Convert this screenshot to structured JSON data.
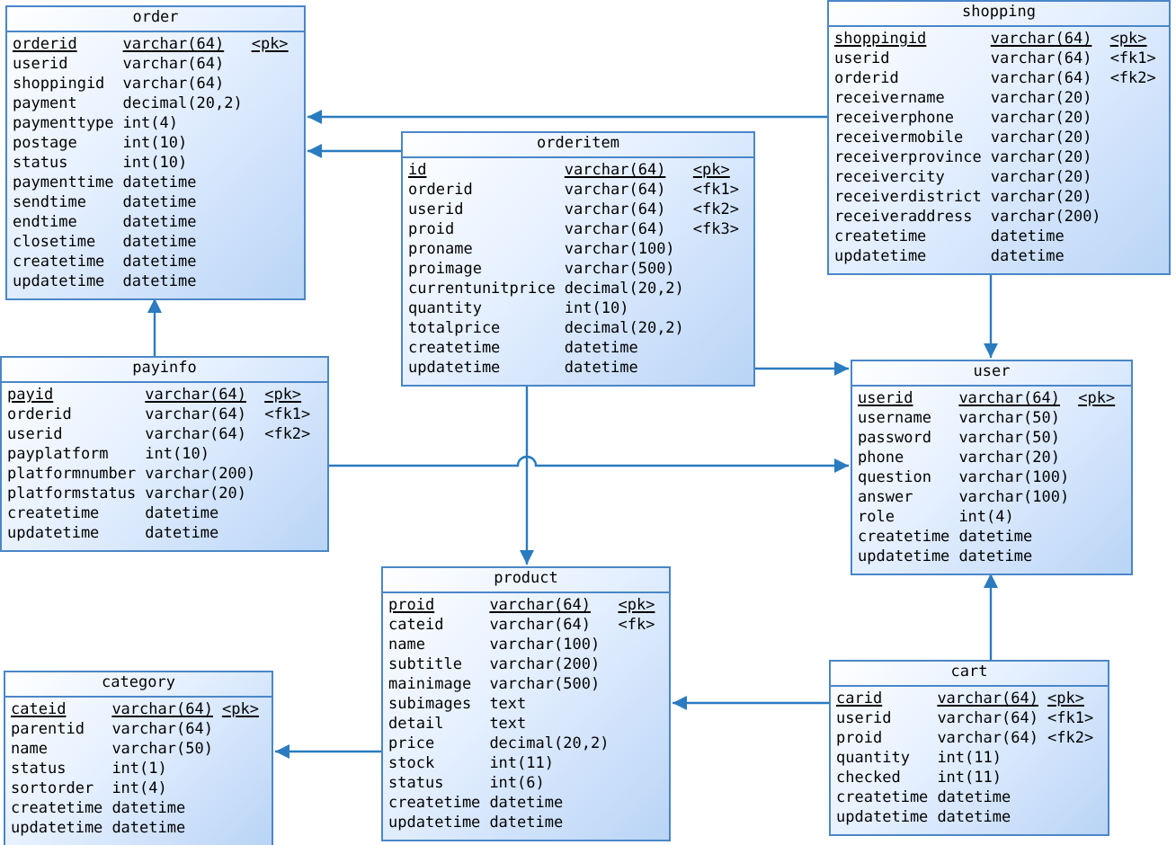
{
  "tables": [
    {
      "name": "order",
      "columns": [
        {
          "name": "orderid",
          "type": "varchar(64)",
          "key": "<pk>",
          "primary_key": true
        },
        {
          "name": "userid",
          "type": "varchar(64)",
          "primary_key": false
        },
        {
          "name": "shoppingid",
          "type": "varchar(64)",
          "primary_key": false
        },
        {
          "name": "payment",
          "type": "decimal(20,2)",
          "primary_key": false
        },
        {
          "name": "paymenttype",
          "type": "int(4)",
          "primary_key": false
        },
        {
          "name": "postage",
          "type": "int(10)",
          "primary_key": false
        },
        {
          "name": "status",
          "type": "int(10)",
          "primary_key": false
        },
        {
          "name": "paymenttime",
          "type": "datetime",
          "primary_key": false
        },
        {
          "name": "sendtime",
          "type": "datetime",
          "primary_key": false
        },
        {
          "name": "endtime",
          "type": "datetime",
          "primary_key": false
        },
        {
          "name": "closetime",
          "type": "datetime",
          "primary_key": false
        },
        {
          "name": "createtime",
          "type": "datetime",
          "primary_key": false
        },
        {
          "name": "updatetime",
          "type": "datetime",
          "primary_key": false
        }
      ]
    },
    {
      "name": "orderitem",
      "columns": [
        {
          "name": "id",
          "type": "varchar(64)",
          "key": "<pk>",
          "primary_key": true
        },
        {
          "name": "orderid",
          "type": "varchar(64)",
          "key": "<fk1>",
          "primary_key": false
        },
        {
          "name": "userid",
          "type": "varchar(64)",
          "key": "<fk2>",
          "primary_key": false
        },
        {
          "name": "proid",
          "type": "varchar(64)",
          "key": "<fk3>",
          "primary_key": false
        },
        {
          "name": "proname",
          "type": "varchar(100)",
          "primary_key": false
        },
        {
          "name": "proimage",
          "type": "varchar(500)",
          "primary_key": false
        },
        {
          "name": "currentunitprice",
          "type": "decimal(20,2)",
          "primary_key": false
        },
        {
          "name": "quantity",
          "type": "int(10)",
          "primary_key": false
        },
        {
          "name": "totalprice",
          "type": "decimal(20,2)",
          "primary_key": false
        },
        {
          "name": "createtime",
          "type": "datetime",
          "primary_key": false
        },
        {
          "name": "updatetime",
          "type": "datetime",
          "primary_key": false
        }
      ]
    },
    {
      "name": "shopping",
      "columns": [
        {
          "name": "shoppingid",
          "type": "varchar(64)",
          "key": "<pk>",
          "primary_key": true
        },
        {
          "name": "userid",
          "type": "varchar(64)",
          "key": "<fk1>",
          "primary_key": false
        },
        {
          "name": "orderid",
          "type": "varchar(64)",
          "key": "<fk2>",
          "primary_key": false
        },
        {
          "name": "receivername",
          "type": "varchar(20)",
          "primary_key": false
        },
        {
          "name": "receiverphone",
          "type": "varchar(20)",
          "primary_key": false
        },
        {
          "name": "receivermobile",
          "type": "varchar(20)",
          "primary_key": false
        },
        {
          "name": "receiverprovince",
          "type": "varchar(20)",
          "primary_key": false
        },
        {
          "name": "receivercity",
          "type": "varchar(20)",
          "primary_key": false
        },
        {
          "name": "receiverdistrict",
          "type": "varchar(20)",
          "primary_key": false
        },
        {
          "name": "receiveraddress",
          "type": "varchar(200)",
          "primary_key": false
        },
        {
          "name": "createtime",
          "type": "datetime",
          "primary_key": false
        },
        {
          "name": "updatetime",
          "type": "datetime",
          "primary_key": false
        }
      ]
    },
    {
      "name": "payinfo",
      "columns": [
        {
          "name": "payid",
          "type": "varchar(64)",
          "key": "<pk>",
          "primary_key": true
        },
        {
          "name": "orderid",
          "type": "varchar(64)",
          "key": "<fk1>",
          "primary_key": false
        },
        {
          "name": "userid",
          "type": "varchar(64)",
          "key": "<fk2>",
          "primary_key": false
        },
        {
          "name": "payplatform",
          "type": "int(10)",
          "primary_key": false
        },
        {
          "name": "platformnumber",
          "type": "varchar(200)",
          "primary_key": false
        },
        {
          "name": "platformstatus",
          "type": "varchar(20)",
          "primary_key": false
        },
        {
          "name": "createtime",
          "type": "datetime",
          "primary_key": false
        },
        {
          "name": "updatetime",
          "type": "datetime",
          "primary_key": false
        }
      ]
    },
    {
      "name": "user",
      "columns": [
        {
          "name": "userid",
          "type": "varchar(64)",
          "key": "<pk>",
          "primary_key": true
        },
        {
          "name": "username",
          "type": "varchar(50)",
          "primary_key": false
        },
        {
          "name": "password",
          "type": "varchar(50)",
          "primary_key": false
        },
        {
          "name": "phone",
          "type": "varchar(20)",
          "primary_key": false
        },
        {
          "name": "question",
          "type": "varchar(100)",
          "primary_key": false
        },
        {
          "name": "answer",
          "type": "varchar(100)",
          "primary_key": false
        },
        {
          "name": "role",
          "type": "int(4)",
          "primary_key": false
        },
        {
          "name": "createtime",
          "type": "datetime",
          "primary_key": false
        },
        {
          "name": "updatetime",
          "type": "datetime",
          "primary_key": false
        }
      ]
    },
    {
      "name": "category",
      "columns": [
        {
          "name": "cateid",
          "type": "varchar(64)",
          "key": "<pk>",
          "primary_key": true
        },
        {
          "name": "parentid",
          "type": "varchar(64)",
          "primary_key": false
        },
        {
          "name": "name",
          "type": "varchar(50)",
          "primary_key": false
        },
        {
          "name": "status",
          "type": "int(1)",
          "primary_key": false
        },
        {
          "name": "sortorder",
          "type": "int(4)",
          "primary_key": false
        },
        {
          "name": "createtime",
          "type": "datetime",
          "primary_key": false
        },
        {
          "name": "updatetime",
          "type": "datetime",
          "primary_key": false
        }
      ]
    },
    {
      "name": "product",
      "columns": [
        {
          "name": "proid",
          "type": "varchar(64)",
          "key": "<pk>",
          "primary_key": true
        },
        {
          "name": "cateid",
          "type": "varchar(64)",
          "key": "<fk>",
          "primary_key": false
        },
        {
          "name": "name",
          "type": "varchar(100)",
          "primary_key": false
        },
        {
          "name": "subtitle",
          "type": "varchar(200)",
          "primary_key": false
        },
        {
          "name": "mainimage",
          "type": "varchar(500)",
          "primary_key": false
        },
        {
          "name": "subimages",
          "type": "text",
          "primary_key": false
        },
        {
          "name": "detail",
          "type": "text",
          "primary_key": false
        },
        {
          "name": "price",
          "type": "decimal(20,2)",
          "primary_key": false
        },
        {
          "name": "stock",
          "type": "int(11)",
          "primary_key": false
        },
        {
          "name": "status",
          "type": "int(6)",
          "primary_key": false
        },
        {
          "name": "createtime",
          "type": "datetime",
          "primary_key": false
        },
        {
          "name": "updatetime",
          "type": "datetime",
          "primary_key": false
        }
      ]
    },
    {
      "name": "cart",
      "columns": [
        {
          "name": "carid",
          "type": "varchar(64)",
          "key": "<pk>",
          "primary_key": true
        },
        {
          "name": "userid",
          "type": "varchar(64)",
          "key": "<fk1>",
          "primary_key": false
        },
        {
          "name": "proid",
          "type": "varchar(64)",
          "key": "<fk2>",
          "primary_key": false
        },
        {
          "name": "quantity",
          "type": "int(11)",
          "primary_key": false
        },
        {
          "name": "checked",
          "type": "int(11)",
          "primary_key": false
        },
        {
          "name": "createtime",
          "type": "datetime",
          "primary_key": false
        },
        {
          "name": "updatetime",
          "type": "datetime",
          "primary_key": false
        }
      ]
    }
  ]
}
